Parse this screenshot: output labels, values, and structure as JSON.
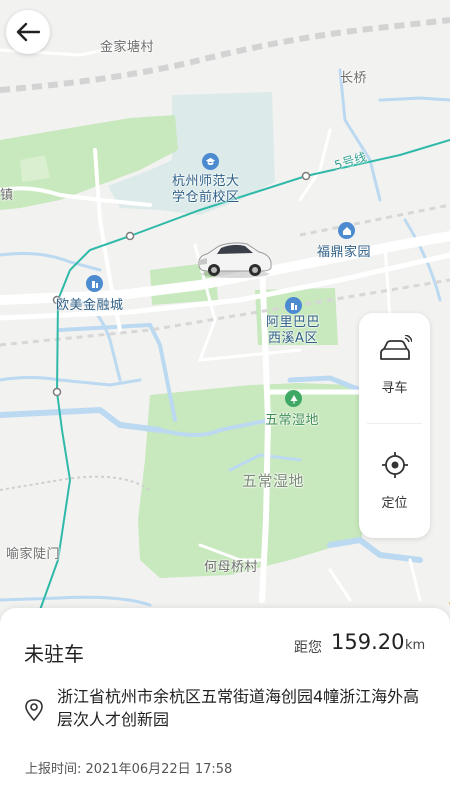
{
  "map": {
    "labels": {
      "jinjia": "金家塘村",
      "changqiao": "长桥",
      "metro_line": "5号线",
      "zhen": "镇",
      "shida": "杭州师范大学仓前校区",
      "shida_l1": "杭州师范大",
      "shida_l2": "学仓前校区",
      "fuding": "福鼎家园",
      "oumei": "欧美金融城",
      "alibaba_l1": "阿里巴巴",
      "alibaba_l2": "西溪A区",
      "wuchang_poi": "五常湿地",
      "wuchang_area": "五常湿地",
      "yujia": "喻家陡门",
      "hemu": "何母桥村"
    }
  },
  "controls": {
    "back_icon": "back-arrow-icon",
    "find_car_label": "寻车",
    "locate_label": "定位"
  },
  "sheet": {
    "status": "未驻车",
    "distance_prefix": "距您",
    "distance_value": "159.20",
    "distance_unit": "km",
    "address": "浙江省杭州市余杭区五常街道海创园4幢浙江海外高层次人才创新园",
    "report_time": "上报时间:  2021年06月22日 17:58"
  },
  "colors": {
    "green_area": "#c8e8bd",
    "water": "#bcd9f2",
    "metro": "#2fb9a9",
    "accent_orange": "#f0a237"
  }
}
